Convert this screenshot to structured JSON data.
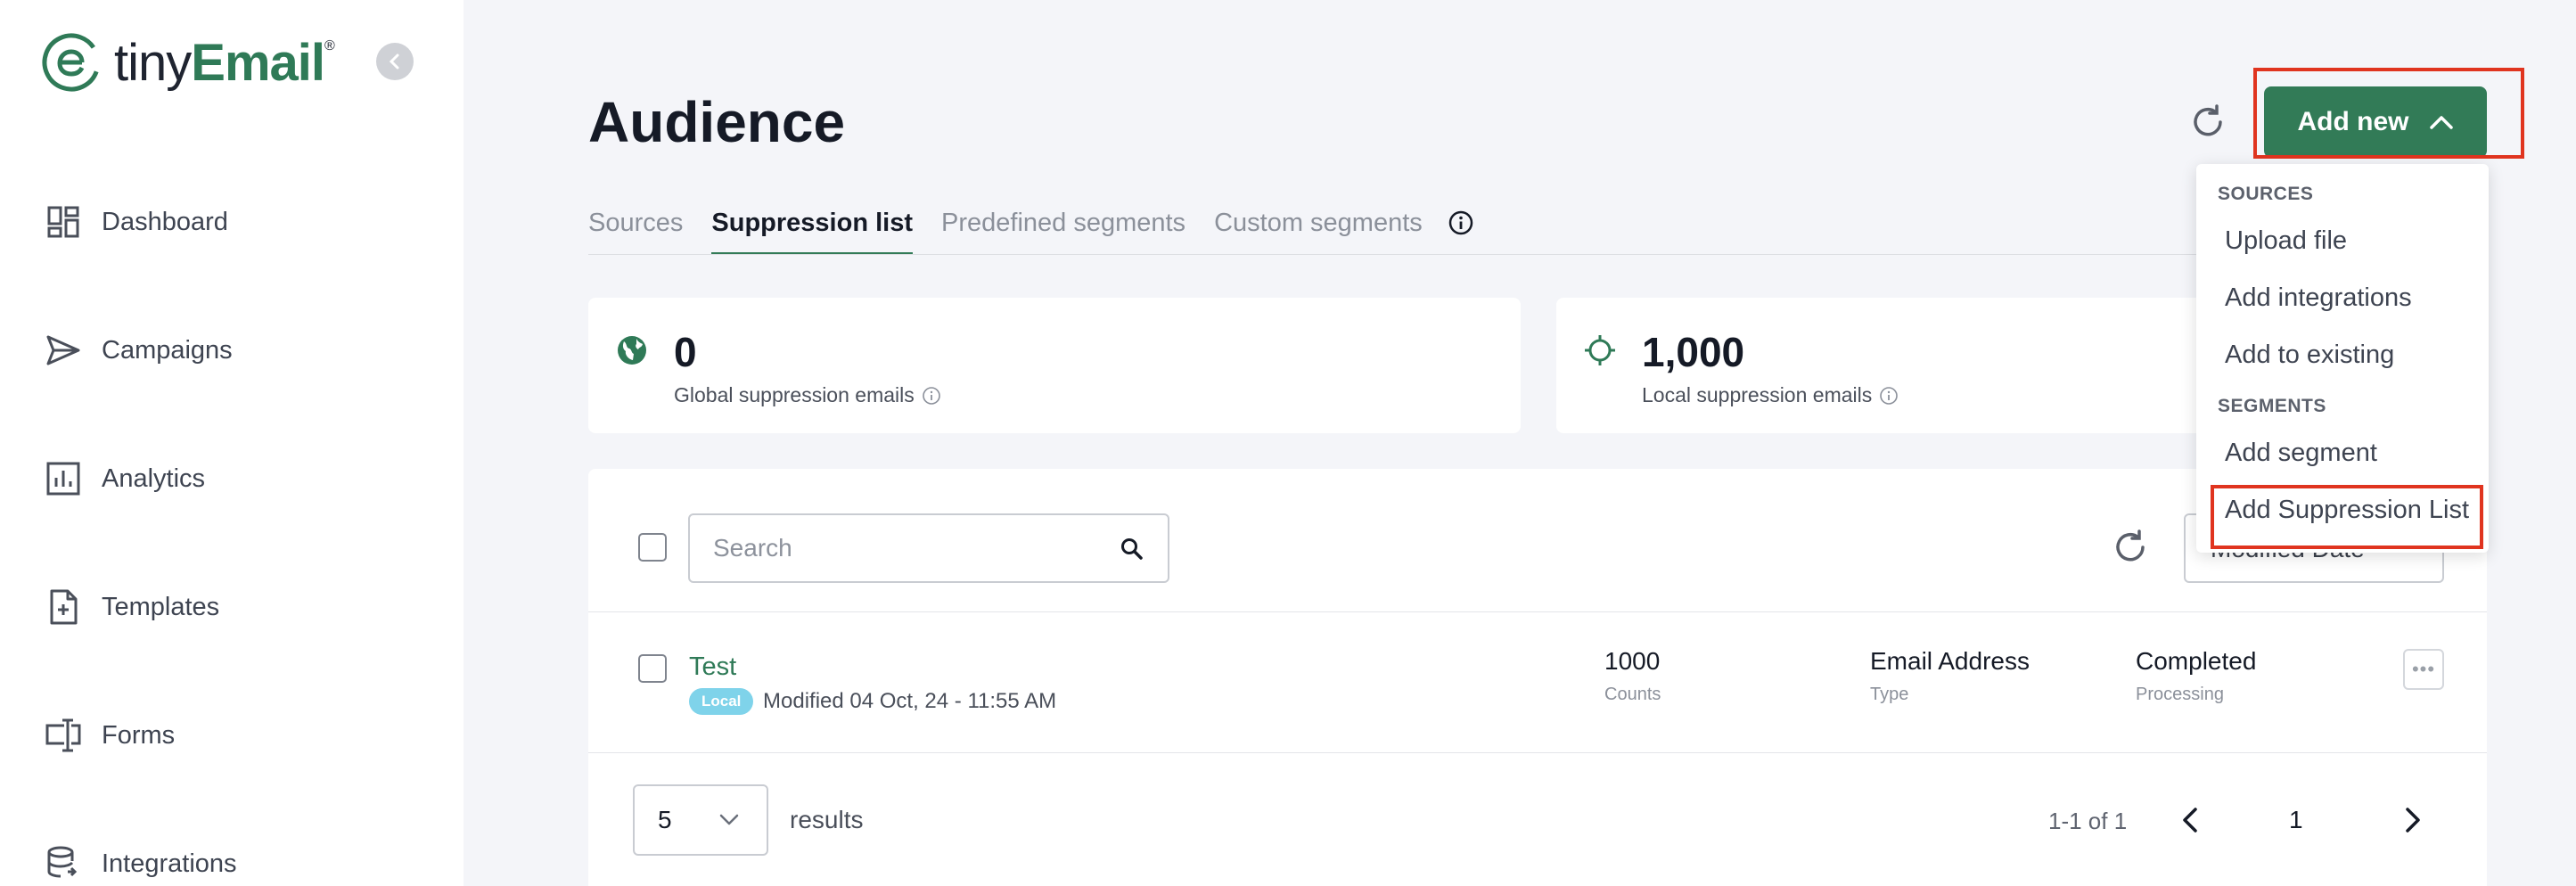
{
  "app": {
    "logo_text_a": "tiny",
    "logo_text_b": "Email",
    "logo_reg": "®"
  },
  "sidebar": {
    "items": [
      {
        "label": "Dashboard",
        "icon": "dashboard-icon"
      },
      {
        "label": "Campaigns",
        "icon": "paper-plane-icon"
      },
      {
        "label": "Analytics",
        "icon": "bar-chart-icon"
      },
      {
        "label": "Templates",
        "icon": "document-plus-icon"
      },
      {
        "label": "Forms",
        "icon": "form-input-icon"
      },
      {
        "label": "Integrations",
        "icon": "database-icon"
      }
    ]
  },
  "header": {
    "title": "Audience",
    "add_new_label": "Add new"
  },
  "tabs": [
    {
      "label": "Sources",
      "active": false
    },
    {
      "label": "Suppression list",
      "active": true
    },
    {
      "label": "Predefined segments",
      "active": false
    },
    {
      "label": "Custom segments",
      "active": false
    }
  ],
  "stats": [
    {
      "value": "0",
      "label": "Global suppression emails",
      "icon": "globe-icon"
    },
    {
      "value": "1,000",
      "label": "Local suppression emails",
      "icon": "crosshair-icon"
    }
  ],
  "table": {
    "search_placeholder": "Search",
    "sort_value": "Modified Date",
    "rows": [
      {
        "name": "Test",
        "badge": "Local",
        "modified": "Modified 04 Oct, 24 - 11:55 AM",
        "count": "1000",
        "count_label": "Counts",
        "type": "Email Address",
        "type_label": "Type",
        "status": "Completed",
        "status_label": "Processing"
      }
    ]
  },
  "pagination": {
    "page_size": "5",
    "results_label": "results",
    "range": "1-1 of 1",
    "current_page": "1"
  },
  "dropdown": {
    "sources_header": "SOURCES",
    "sources_items": [
      "Upload file",
      "Add integrations",
      "Add to existing"
    ],
    "segments_header": "SEGMENTS",
    "segments_items": [
      "Add segment",
      "Add Suppression List"
    ]
  },
  "colors": {
    "brand_green": "#327b57",
    "highlight_red": "#e0341f",
    "badge_blue": "#7fd3ea"
  }
}
